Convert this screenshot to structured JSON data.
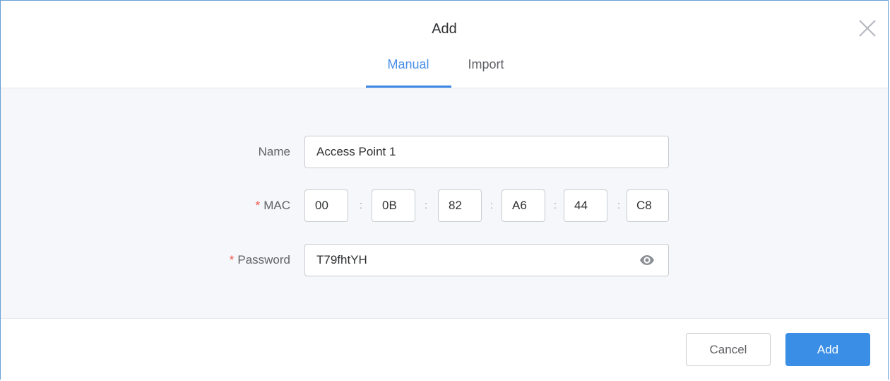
{
  "dialog": {
    "title": "Add",
    "close_icon": "close-icon"
  },
  "tabs": [
    {
      "label": "Manual",
      "active": true
    },
    {
      "label": "Import",
      "active": false
    }
  ],
  "form": {
    "name": {
      "label": "Name",
      "value": "Access Point 1"
    },
    "mac": {
      "label": "MAC",
      "required_mark": "*",
      "separator": ":",
      "octets": [
        "00",
        "0B",
        "82",
        "A6",
        "44",
        "C8"
      ]
    },
    "password": {
      "label": "Password",
      "required_mark": "*",
      "value": "T79fhtYH",
      "toggle_icon": "eye-icon"
    }
  },
  "footer": {
    "cancel_label": "Cancel",
    "add_label": "Add"
  },
  "colors": {
    "accent": "#3a8ee6",
    "required": "#f5564a",
    "body_background": "#f5f7fa"
  }
}
